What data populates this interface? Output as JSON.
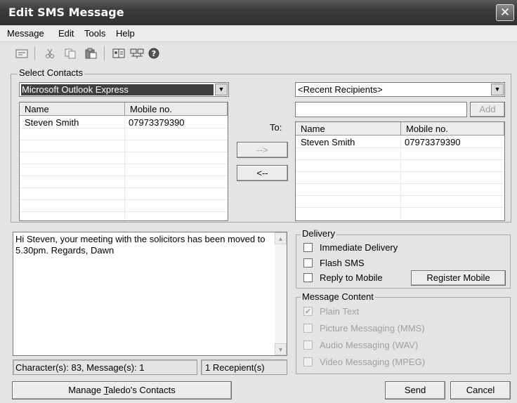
{
  "window": {
    "title": "Edit SMS Message",
    "close_glyph": "✕"
  },
  "menu": [
    "Message",
    "Edit",
    "Tools",
    "Help"
  ],
  "toolbar_icons": [
    "message-icon",
    "cut-icon",
    "copy-icon",
    "paste-icon",
    "address-book-icon",
    "network-icon",
    "help-icon"
  ],
  "select_contacts": {
    "label": "Select Contacts",
    "source": "Microsoft Outlook Express",
    "columns": [
      "Name",
      "Mobile no."
    ],
    "rows": [
      {
        "name": "Steven Smith",
        "mobile": "07973379390"
      }
    ]
  },
  "transfer": {
    "to_label": "To:",
    "add_arrow": "-->",
    "remove_arrow": "<--"
  },
  "recipients": {
    "recent": "<Recent Recipients>",
    "input_value": "",
    "add_label": "Add",
    "columns": [
      "Name",
      "Mobile no."
    ],
    "rows": [
      {
        "name": "Steven Smith",
        "mobile": "07973379390"
      }
    ]
  },
  "message": {
    "text": "Hi Steven, your meeting with the solicitors has been moved to 5.30pm. Regards, Dawn",
    "characters_status": "Character(s): 83, Message(s): 1",
    "recipients_status": "1 Recepient(s)"
  },
  "delivery": {
    "label": "Delivery",
    "immediate": "Immediate Delivery",
    "flash": "Flash SMS",
    "reply": "Reply to Mobile",
    "register": "Register Mobile"
  },
  "content": {
    "label": "Message Content",
    "plain": "Plain Text",
    "picture": "Picture Messaging (MMS)",
    "audio": "Audio Messaging (WAV)",
    "video": "Video Messaging (MPEG)"
  },
  "footer": {
    "manage_pre": "Manage ",
    "manage_u": "T",
    "manage_post": "aledo's Contacts",
    "send": "Send",
    "cancel": "Cancel"
  }
}
